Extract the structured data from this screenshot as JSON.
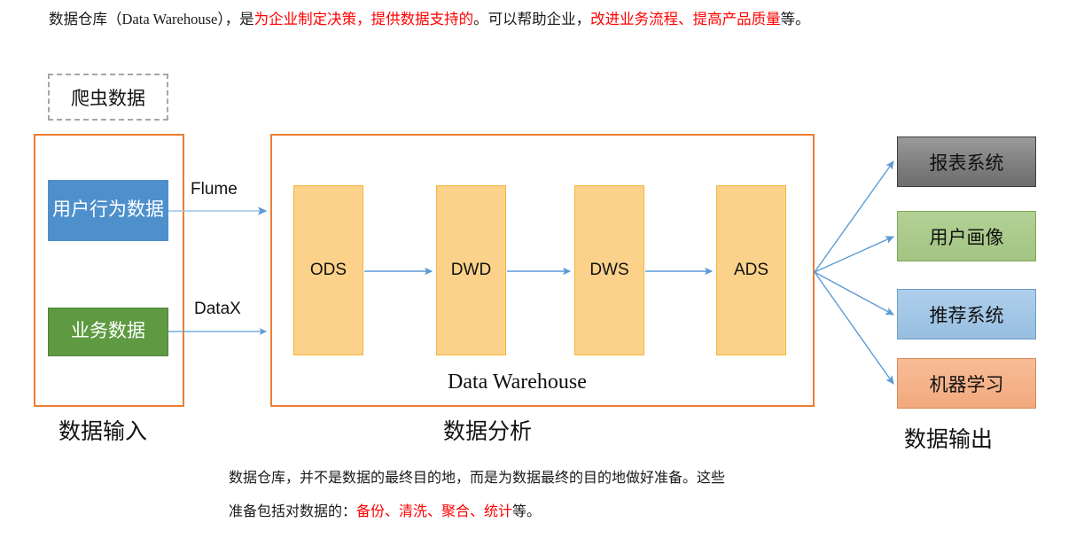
{
  "notes": {
    "top": {
      "seg1": "数据仓库（Data Warehouse），是",
      "seg2_red": "为企业制定决策，提供数据支持的",
      "seg3": "。可以帮助企业，",
      "seg4_red": "改进业务流程、提高产品质量",
      "seg5": "等。"
    },
    "bottom_line1": "数据仓库，并不是数据的最终目的地，而是为数据最终的目的地做好准备。这些",
    "bottom_line2_prefix": "准备包括对数据的：",
    "bottom_line2_red": "备份、清洗、聚合、统计",
    "bottom_line2_suffix": "等。"
  },
  "sections": {
    "input": {
      "caption": "数据输入",
      "crawler_box": "爬虫数据",
      "sources": [
        {
          "label": "用户行为数据",
          "color": "#4E90CC"
        },
        {
          "label": "业务数据",
          "color": "#5E9A41"
        }
      ],
      "transports": [
        {
          "label": "Flume"
        },
        {
          "label": "DataX"
        }
      ]
    },
    "analysis": {
      "caption": "数据分析",
      "warehouse_title": "Data Warehouse",
      "layers": [
        {
          "label": "ODS"
        },
        {
          "label": "DWD"
        },
        {
          "label": "DWS"
        },
        {
          "label": "ADS"
        }
      ]
    },
    "output": {
      "caption": "数据输出",
      "targets": [
        {
          "label": "报表系统",
          "color": "#7F7F7F"
        },
        {
          "label": "用户画像",
          "color": "#A3C483"
        },
        {
          "label": "推荐系统",
          "color": "#97BEE0"
        },
        {
          "label": "机器学习",
          "color": "#F2A97E"
        }
      ]
    }
  },
  "colors": {
    "section_border": "#ED7D31",
    "layer_fill": "#FCD28B",
    "layer_border": "#F2B63D",
    "arrow": "#5B9BD5",
    "dashed_border": "#A6A6A6",
    "accent_red": "#FF0000"
  }
}
